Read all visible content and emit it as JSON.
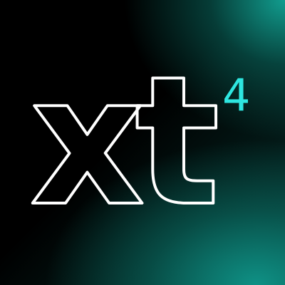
{
  "logo": {
    "wordmark": "xt",
    "superscript": "4",
    "colors": {
      "background": "#000000",
      "glow": "#12a596",
      "outline": "#ffffff",
      "superscript": "#2ee6e0"
    }
  }
}
